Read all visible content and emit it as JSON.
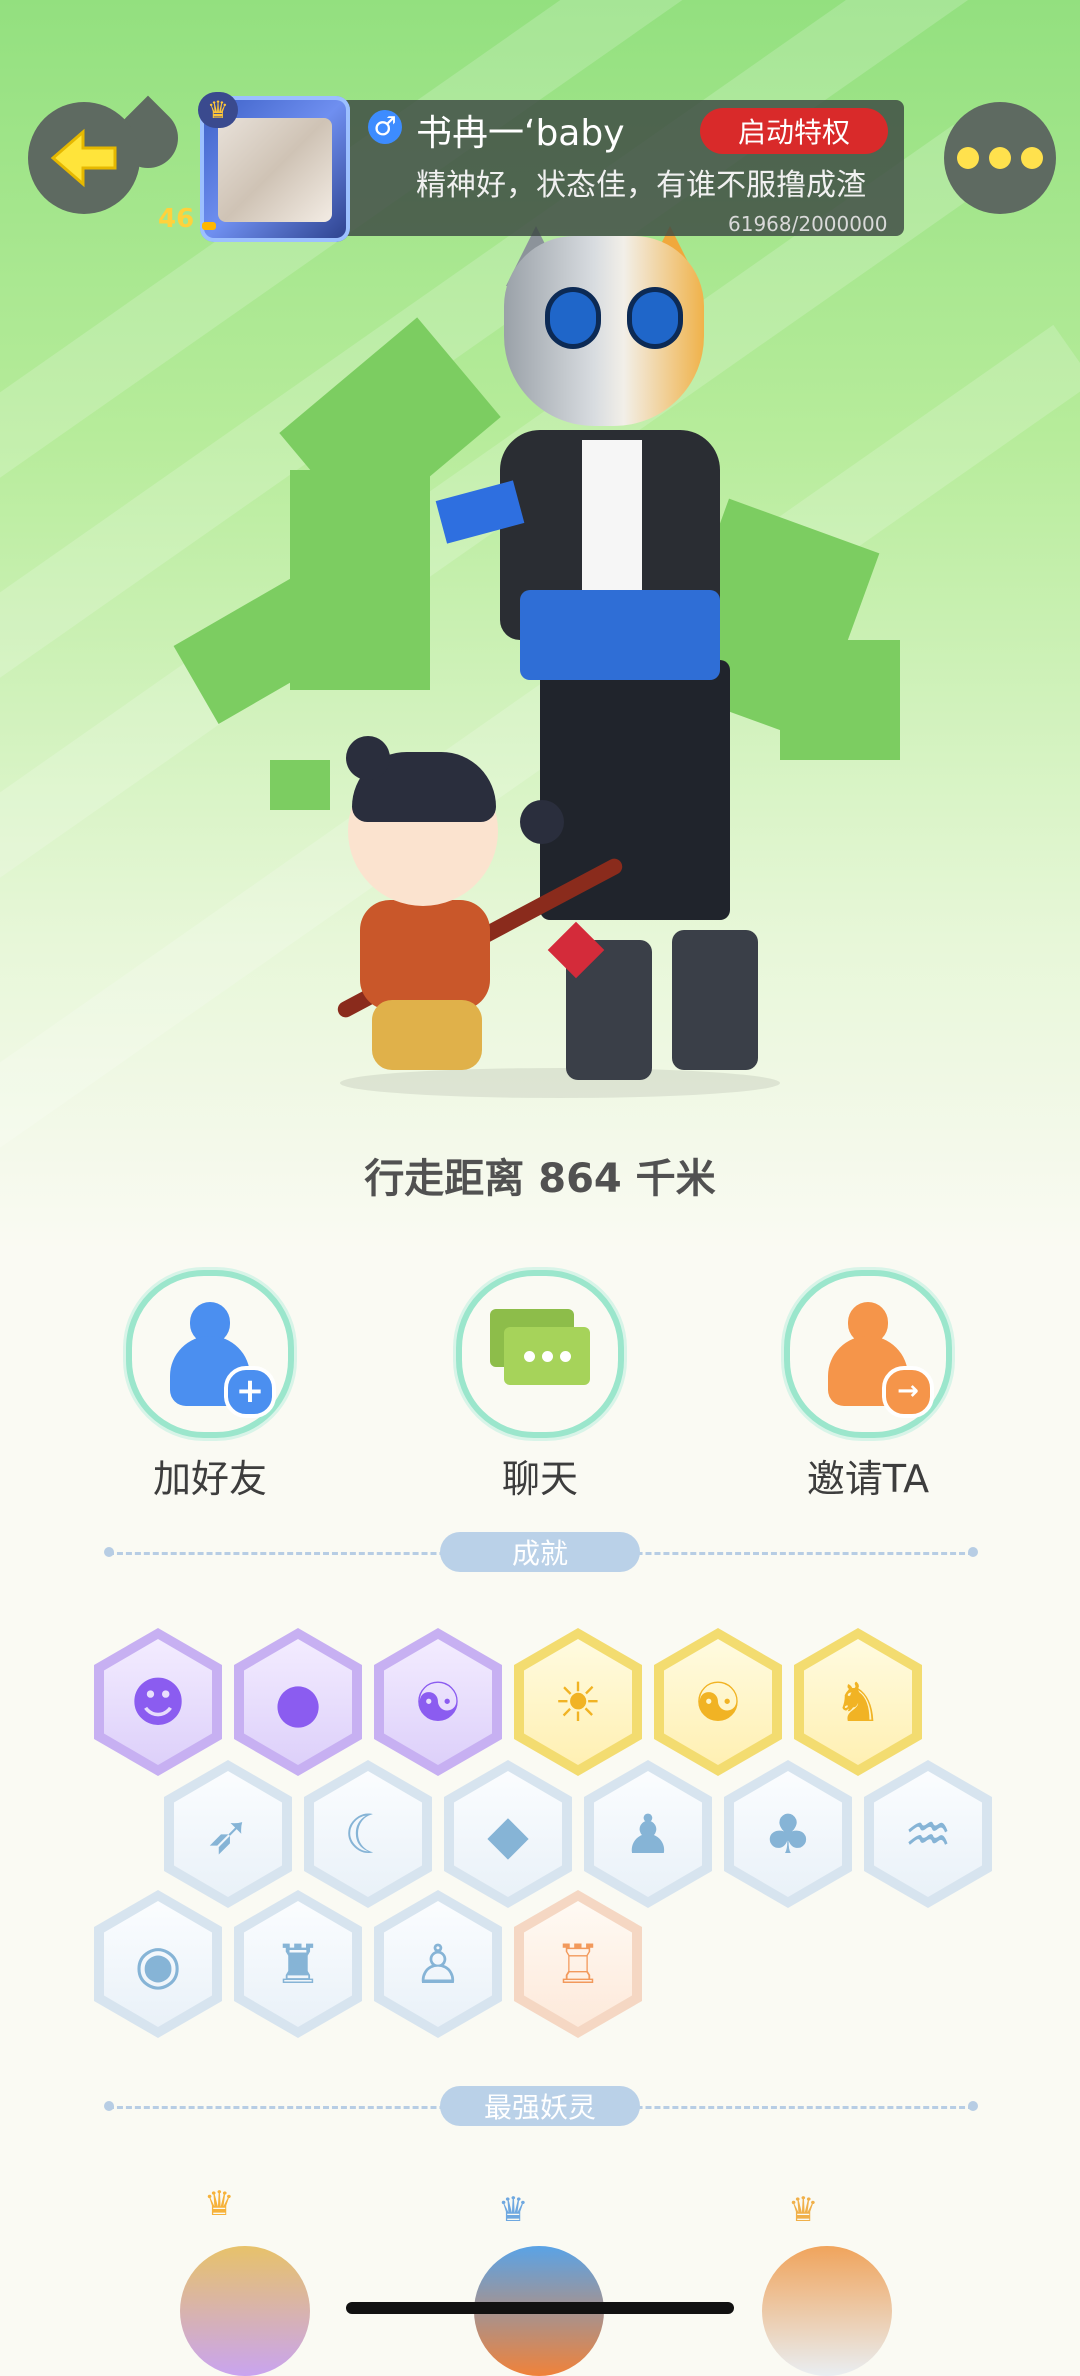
{
  "header": {
    "nickname": "书冉一‘baby",
    "gender_symbol": "♂",
    "privilege_button": "启动特权",
    "signature": "精神好，状态佳，有谁不服撸成渣",
    "level": "46",
    "exp_text": "61968/2000000",
    "level_progress": 0.031
  },
  "distance_text": "行走距离 864 千米",
  "actions": [
    {
      "label": "加好友",
      "icon": "add-friend-icon",
      "badge": "+",
      "color": "#4b8ff0"
    },
    {
      "label": "聊天",
      "icon": "chat-icon",
      "color": "#8dbd4a"
    },
    {
      "label": "邀请TA",
      "icon": "invite-icon",
      "badge": "→",
      "color": "#f5954a"
    }
  ],
  "sections": {
    "achievements": "成就",
    "strongest_spirit": "最强妖灵"
  },
  "achievements": [
    {
      "icon": "demon-face-icon",
      "glyph": "☻",
      "tier": "purple"
    },
    {
      "icon": "orb-icon",
      "glyph": "●",
      "tier": "purple"
    },
    {
      "icon": "yin-yang-swirl-icon",
      "glyph": "☯",
      "tier": "purple"
    },
    {
      "icon": "sun-trophy-icon",
      "glyph": "☀",
      "tier": "gold"
    },
    {
      "icon": "taiji-book-icon",
      "glyph": "☯",
      "tier": "gold"
    },
    {
      "icon": "fox-book-icon",
      "glyph": "♞",
      "tier": "gold"
    },
    {
      "icon": "sneaker-icon",
      "glyph": "➶",
      "tier": "blue"
    },
    {
      "icon": "moon-icon",
      "glyph": "☾",
      "tier": "blue"
    },
    {
      "icon": "crystal-icon",
      "glyph": "◆",
      "tier": "blue"
    },
    {
      "icon": "monkey-statue-icon",
      "glyph": "♟",
      "tier": "blue"
    },
    {
      "icon": "cat-balloon-icon",
      "glyph": "♣",
      "tier": "blue"
    },
    {
      "icon": "koi-icon",
      "glyph": "♒",
      "tier": "blue"
    },
    {
      "icon": "shield-icon",
      "glyph": "◉",
      "tier": "blue"
    },
    {
      "icon": "demon-statue-icon",
      "glyph": "♜",
      "tier": "blue"
    },
    {
      "icon": "ghost-icon",
      "glyph": "♙",
      "tier": "blue"
    },
    {
      "icon": "cat-cart-icon",
      "glyph": "♖",
      "tier": "orange"
    }
  ],
  "spirits": [
    {
      "icon": "purple-hair-spirit-avatar",
      "color": "#c9a4f0"
    },
    {
      "icon": "colorful-spirit-avatar",
      "color": "#5aa3e6"
    },
    {
      "icon": "silver-hair-spirit-avatar",
      "color": "#f0a45c"
    }
  ],
  "colors": {
    "accent_green": "#93e07f",
    "privilege_red": "#d92a2a",
    "level_gold": "#ffd23c"
  }
}
